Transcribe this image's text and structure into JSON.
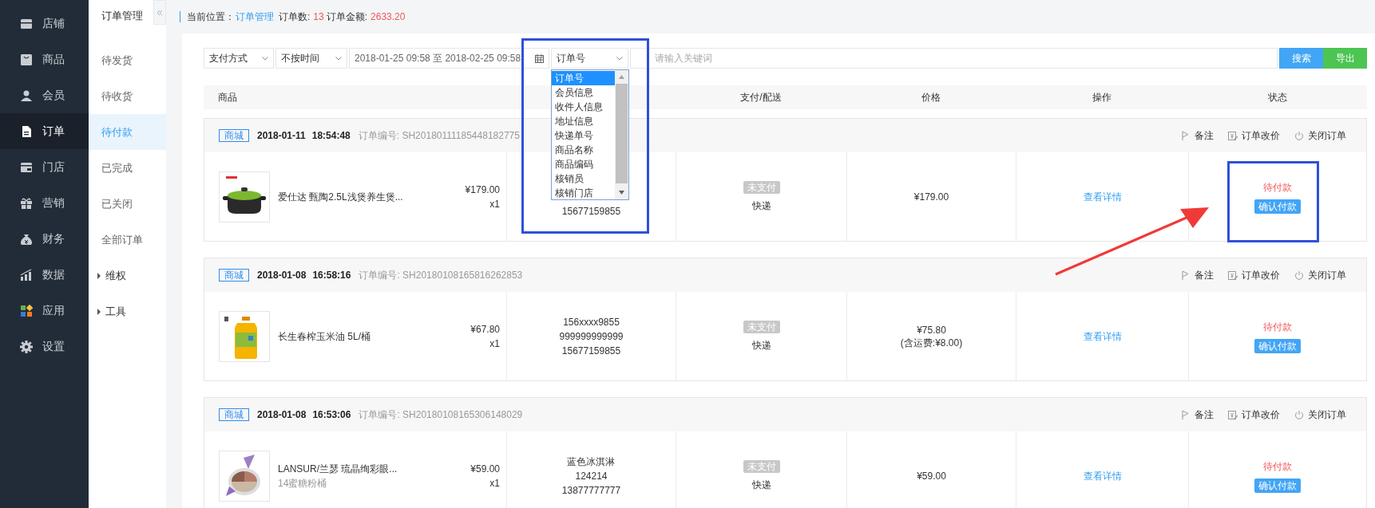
{
  "main_nav": [
    {
      "label": "店铺",
      "selected": false
    },
    {
      "label": "商品",
      "selected": false
    },
    {
      "label": "会员",
      "selected": false
    },
    {
      "label": "订单",
      "selected": true
    },
    {
      "label": "门店",
      "selected": false
    },
    {
      "label": "营销",
      "selected": false
    },
    {
      "label": "财务",
      "selected": false
    },
    {
      "label": "数据",
      "selected": false
    },
    {
      "label": "应用",
      "selected": false
    },
    {
      "label": "设置",
      "selected": false
    }
  ],
  "sub_nav": {
    "title": "订单管理",
    "items": [
      {
        "kind": "link",
        "label": "待发货",
        "selected": false
      },
      {
        "kind": "link",
        "label": "待收货",
        "selected": false
      },
      {
        "kind": "link",
        "label": "待付款",
        "selected": true
      },
      {
        "kind": "link",
        "label": "已完成",
        "selected": false
      },
      {
        "kind": "link",
        "label": "已关闭",
        "selected": false
      },
      {
        "kind": "link",
        "label": "全部订单",
        "selected": false
      },
      {
        "kind": "group",
        "label": "维权",
        "expanded": false
      },
      {
        "kind": "group",
        "label": "工具",
        "expanded": false
      }
    ]
  },
  "breadcrumb": {
    "label": "当前位置：",
    "link": "订单管理",
    "stats": [
      {
        "label": "订单数:",
        "value": "13"
      },
      {
        "label": "订单金额:",
        "value": "2633.20"
      }
    ]
  },
  "filters": {
    "payment": "支付方式",
    "time": "不按时间",
    "date_range": "2018-01-25 09:58 至 2018-02-25 09:58",
    "search_by": {
      "value": "订单号",
      "expanded": true,
      "options": [
        {
          "label": "订单号",
          "selected": true
        },
        {
          "label": "会员信息",
          "selected": false
        },
        {
          "label": "收件人信息",
          "selected": false
        },
        {
          "label": "地址信息",
          "selected": false
        },
        {
          "label": "快递单号",
          "selected": false
        },
        {
          "label": "商品名称",
          "selected": false
        },
        {
          "label": "商品编码",
          "selected": false
        },
        {
          "label": "核销员",
          "selected": false
        },
        {
          "label": "核销门店",
          "selected": false
        }
      ]
    },
    "keyword": {
      "placeholder": "请输入关键词"
    },
    "buttons": [
      {
        "kind": "search",
        "label": "搜索"
      },
      {
        "kind": "export",
        "label": "导出"
      }
    ]
  },
  "table": {
    "columns": [
      "商品",
      "支付/配送",
      "价格",
      "操作",
      "状态"
    ],
    "orders": [
      {
        "source": "商城",
        "date": "2018-01-11",
        "time": "18:54:48",
        "order_no": "订单编号: SH20180111185448182775",
        "actions": [
          "备注",
          "订单改价",
          "关闭订单"
        ],
        "product": {
          "name": "爱仕达 甄陶2.5L浅煲养生煲...",
          "price": "¥179.00",
          "qty": "x1"
        },
        "buyer": [
          "15677159855"
        ],
        "pay_status": "未支付",
        "delivery": "快递",
        "price": [
          "¥179.00"
        ],
        "link": "查看详情",
        "status": "待付款",
        "confirm": "确认付款"
      },
      {
        "source": "商城",
        "date": "2018-01-08",
        "time": "16:58:16",
        "order_no": "订单编号: SH20180108165816262853",
        "actions": [
          "备注",
          "订单改价",
          "关闭订单"
        ],
        "product": {
          "name": "长生春榨玉米油 5L/桶",
          "price": "¥67.80",
          "qty": "x1"
        },
        "buyer": [
          "156xxxx9855",
          "999999999999",
          "15677159855"
        ],
        "pay_status": "未支付",
        "delivery": "快递",
        "price": [
          "¥75.80",
          "(含运费:¥8.00)"
        ],
        "link": "查看详情",
        "status": "待付款",
        "confirm": "确认付款"
      },
      {
        "source": "商城",
        "date": "2018-01-08",
        "time": "16:53:06",
        "order_no": "订单编号: SH20180108165306148029",
        "actions": [
          "备注",
          "订单改价",
          "关闭订单"
        ],
        "product": {
          "name": "LANSUR/兰瑟 琉晶绚彩眼...",
          "variant": "14蜜糖粉桶",
          "price": "¥59.00",
          "qty": "x1"
        },
        "buyer": [
          "蓝色冰淇淋",
          "124214",
          "13877777777"
        ],
        "pay_status": "未支付",
        "delivery": "快递",
        "price": [
          "¥59.00"
        ],
        "link": "查看详情",
        "status": "待付款",
        "confirm": "确认付款"
      }
    ]
  }
}
